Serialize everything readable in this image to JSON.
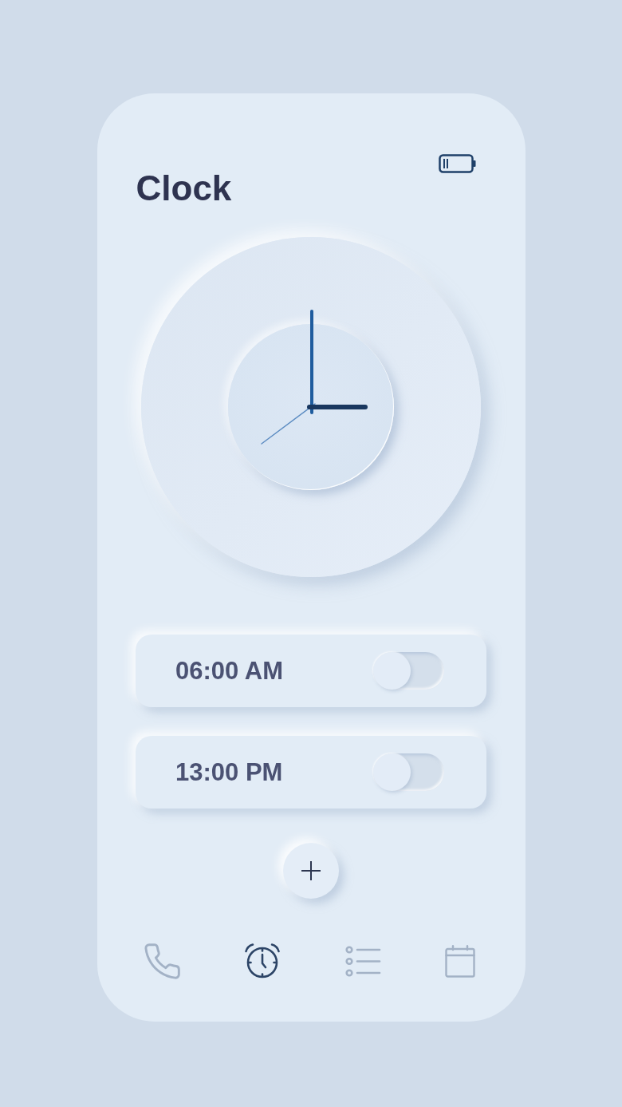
{
  "header": {
    "title": "Clock"
  },
  "alarms": [
    {
      "time": "06:00 AM",
      "on": false
    },
    {
      "time": "13:00 PM",
      "on": false
    }
  ],
  "nav": [
    {
      "kind": "phone",
      "selected": false
    },
    {
      "kind": "alarm",
      "selected": true
    },
    {
      "kind": "list",
      "selected": false
    },
    {
      "kind": "calendar",
      "selected": false
    }
  ]
}
